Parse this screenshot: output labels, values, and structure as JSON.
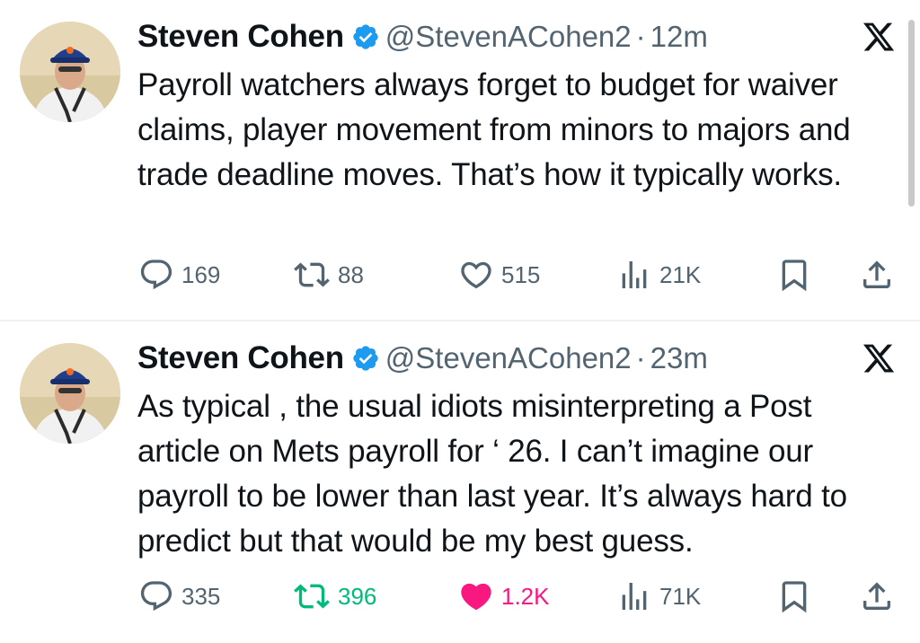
{
  "tweets": [
    {
      "author_name": "Steven Cohen",
      "handle": "@StevenACohen2",
      "separator": "·",
      "time": "12m",
      "text": "Payroll watchers always forget to budget for waiver claims, player movement from minors to majors and trade deadline moves. That’s how it typically works.",
      "replies": "169",
      "reposts": "88",
      "likes": "515",
      "views": "21K",
      "reposted": false,
      "liked": false
    },
    {
      "author_name": "Steven Cohen",
      "handle": "@StevenACohen2",
      "separator": "·",
      "time": "23m",
      "text": "As typical , the usual idiots misinterpreting a Post article on Mets payroll for ‘ 26. I can’t imagine our payroll to be lower than last year. It’s always hard to predict but that would be my best guess.",
      "replies": "335",
      "reposts": "396",
      "likes": "1.2K",
      "views": "71K",
      "reposted": true,
      "liked": true
    }
  ],
  "icons": {
    "verified": "verified-badge-icon",
    "logo": "x-logo-icon",
    "reply": "reply-icon",
    "repost": "repost-icon",
    "like": "heart-icon",
    "views": "views-icon",
    "bookmark": "bookmark-icon",
    "share": "share-icon"
  },
  "colors": {
    "text": "#0f1419",
    "secondary": "#536471",
    "verified": "#1d9bf0",
    "repost_active": "#00ba7c",
    "like_active": "#f91880"
  }
}
